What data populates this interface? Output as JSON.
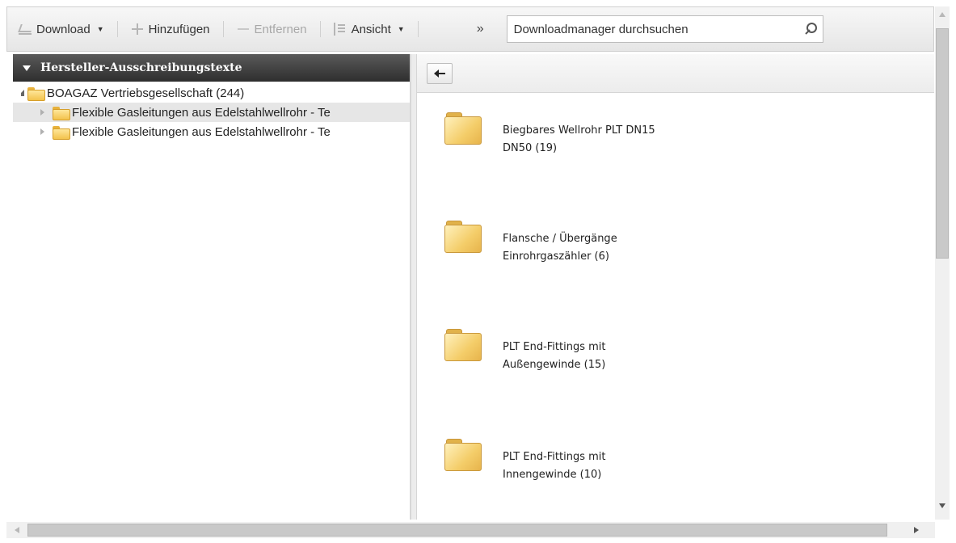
{
  "toolbar": {
    "download_label": "Download",
    "add_label": "Hinzufügen",
    "remove_label": "Entfernen",
    "view_label": "Ansicht",
    "more_label": "»",
    "search_placeholder": "Downloadmanager durchsuchen"
  },
  "left_panel": {
    "title": "Hersteller-Ausschreibungstexte",
    "tree": {
      "root_label": "BOAGAZ Vertriebsgesellschaft (244)",
      "children": [
        {
          "label": "Flexible Gasleitungen aus Edelstahlwellrohr - Te"
        },
        {
          "label": "Flexible Gasleitungen aus Edelstahlwellrohr - Te"
        }
      ]
    }
  },
  "right_panel": {
    "folders": [
      {
        "line1": "Biegbares Wellrohr PLT DN15",
        "line2": "DN50 (19)"
      },
      {
        "line1": "Flansche / Übergänge",
        "line2": "Einrohrgaszähler (6)"
      },
      {
        "line1": "PLT End-Fittings mit",
        "line2": "Außengewinde (15)"
      },
      {
        "line1": "PLT End-Fittings mit",
        "line2": "Innengewinde (10)"
      }
    ]
  },
  "icons": {
    "download": "download-icon",
    "add": "plus-icon",
    "remove": "minus-icon",
    "view": "list-view-icon",
    "search": "magnifier-icon",
    "back": "left-arrow-icon",
    "folder": "folder-icon"
  },
  "colors": {
    "header_bg": "#3a3a3a",
    "folder_yellow": "#f3c24c",
    "selected_row": "#e6e6e6",
    "disabled_text": "#a8a8a8"
  }
}
